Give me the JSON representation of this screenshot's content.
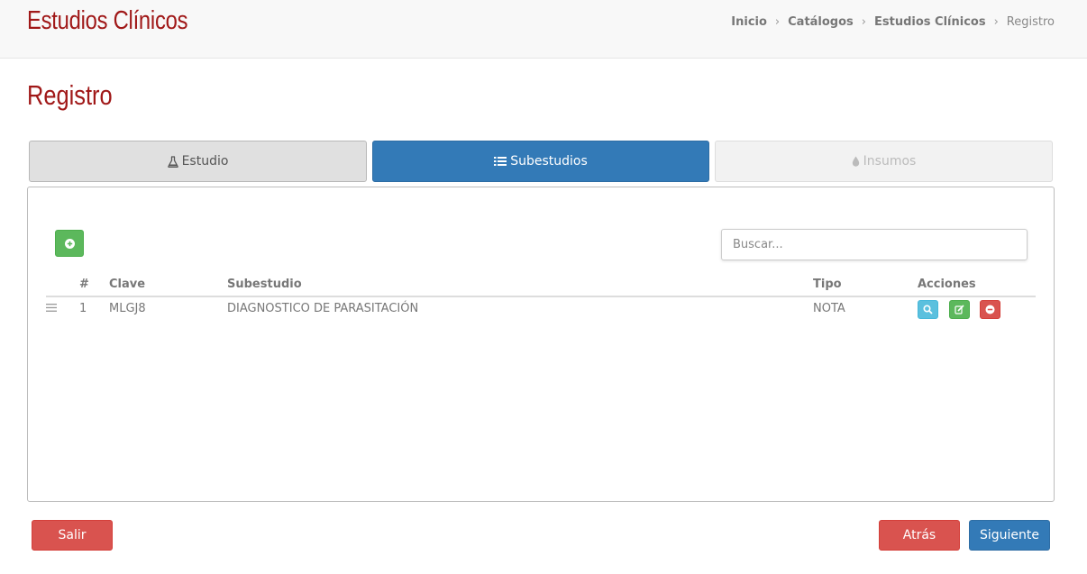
{
  "header": {
    "app_title": "Estudios Clínicos",
    "breadcrumb": [
      "Inicio",
      "Catálogos",
      "Estudios Clínicos",
      "Registro"
    ]
  },
  "page_title": "Registro",
  "tabs": [
    {
      "label": "Estudio",
      "icon": "flask-icon",
      "state": "default"
    },
    {
      "label": "Subestudios",
      "icon": "list-icon",
      "state": "active"
    },
    {
      "label": "Insumos",
      "icon": "tint-icon",
      "state": "disabled"
    }
  ],
  "search": {
    "placeholder": "Buscar..."
  },
  "table": {
    "columns": [
      "#",
      "Clave",
      "Subestudio",
      "Tipo",
      "Acciones"
    ],
    "rows": [
      {
        "num": "1",
        "clave": "MLGJ8",
        "subestudio": "DIAGNOSTICO DE PARASITACIÓN",
        "tipo": "NOTA"
      }
    ]
  },
  "footer": {
    "exit_label": "Salir",
    "back_label": "Atrás",
    "next_label": "Siguiente"
  },
  "colors": {
    "brand": "#a01818",
    "primary": "#337ab7",
    "success": "#5cb85c",
    "info": "#5bc0de",
    "danger": "#d9534f"
  }
}
